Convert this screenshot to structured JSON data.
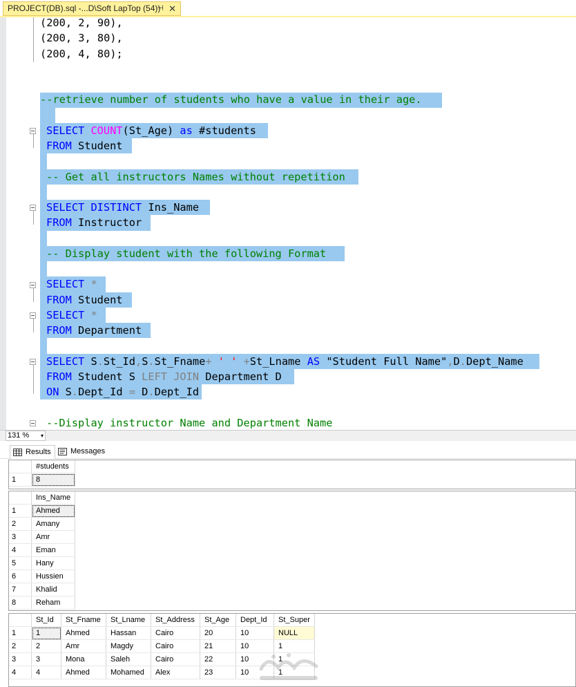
{
  "tab": {
    "title": "PROJECT(DB).sql -...D\\Soft LapTop (54))",
    "pin_icon": "⊣",
    "close_icon": "✕"
  },
  "editor": {
    "lines": [
      [
        "(200, 2, 90),"
      ],
      [
        "(200, 3, 80),"
      ],
      [
        "(200, 4, 80);"
      ],
      [
        "--retrieve number of students who have a value in their age."
      ],
      [
        "SELECT ",
        "COUNT",
        "(St_Age) ",
        "as",
        " #students"
      ],
      [
        "FROM",
        " Student"
      ],
      [
        "-- Get all instructors Names without repetition"
      ],
      [
        "SELECT DISTINCT",
        " Ins_Name"
      ],
      [
        "FROM",
        " Instructor"
      ],
      [
        "-- Display student with the following Format"
      ],
      [
        "SELECT",
        " *"
      ],
      [
        "FROM",
        " Student"
      ],
      [
        "SELECT",
        " *"
      ],
      [
        "FROM",
        " Department"
      ],
      [
        "SELECT",
        " S",
        ".",
        "St_Id",
        ",",
        "S",
        ".",
        "St_Fname",
        "+",
        " ' '",
        " +",
        "St_Lname ",
        "AS",
        " \"Student Full Name\"",
        ",",
        "D",
        ".",
        "Dept_Name"
      ],
      [
        "FROM",
        " Student S ",
        "LEFT JOIN",
        " Department D"
      ],
      [
        "ON",
        " S",
        ".",
        "Dept_Id ",
        "=",
        " D",
        ".",
        "Dept_Id"
      ],
      [
        "--Display instructor Name and Department Name"
      ]
    ]
  },
  "zoom": {
    "value": "131 %",
    "arrow": "▾"
  },
  "results_tabs": {
    "results": "Results",
    "messages": "Messages"
  },
  "grid1": {
    "headers": [
      "#students"
    ],
    "rows": [
      [
        "1",
        "8"
      ]
    ]
  },
  "grid2": {
    "headers": [
      "Ins_Name"
    ],
    "rows": [
      [
        "1",
        "Ahmed"
      ],
      [
        "2",
        "Amany"
      ],
      [
        "3",
        "Amr"
      ],
      [
        "4",
        "Eman"
      ],
      [
        "5",
        "Hany"
      ],
      [
        "6",
        "Hussien"
      ],
      [
        "7",
        "Khalid"
      ],
      [
        "8",
        "Reham"
      ]
    ]
  },
  "grid3": {
    "headers": [
      "St_Id",
      "St_Fname",
      "St_Lname",
      "St_Address",
      "St_Age",
      "Dept_Id",
      "St_Super"
    ],
    "rows": [
      [
        "1",
        "1",
        "Ahmed",
        "Hassan",
        "Cairo",
        "20",
        "10",
        "NULL"
      ],
      [
        "2",
        "2",
        "Amr",
        "Magdy",
        "Cairo",
        "21",
        "10",
        "1"
      ],
      [
        "3",
        "3",
        "Mona",
        "Saleh",
        "Cairo",
        "22",
        "10",
        "1"
      ],
      [
        "4",
        "4",
        "Ahmed",
        "Mohamed",
        "Alex",
        "23",
        "10",
        "1"
      ]
    ]
  },
  "colors": {
    "tab_active": "#fff29d",
    "selection": "#99c9ef",
    "keyword": "#0000ff",
    "function": "#ff00ff",
    "comment": "#008000",
    "operator": "#808080"
  }
}
